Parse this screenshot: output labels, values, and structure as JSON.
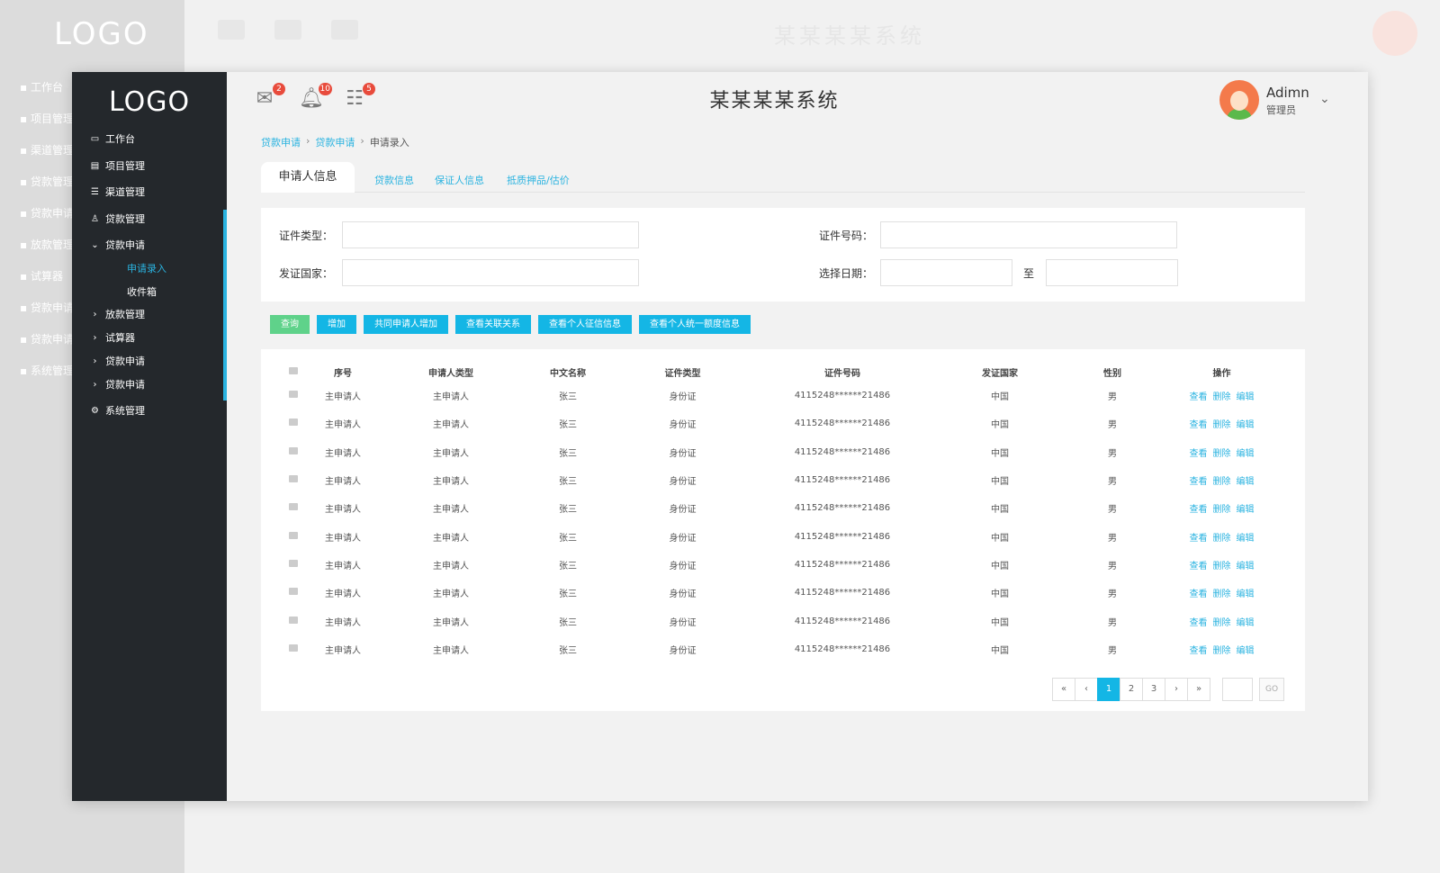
{
  "app": {
    "logo": "LOGO",
    "title": "某某某某系统"
  },
  "topbar": {
    "icons": [
      {
        "name": "mail-icon",
        "badge": "2"
      },
      {
        "name": "bell-icon",
        "badge": "10"
      },
      {
        "name": "list-icon",
        "badge": "5"
      }
    ],
    "user": {
      "name": "Adimn",
      "role": "管理员"
    }
  },
  "sidebar": {
    "items": [
      {
        "label": "工作台",
        "icon": "desktop-icon"
      },
      {
        "label": "项目管理",
        "icon": "project-icon"
      },
      {
        "label": "渠道管理",
        "icon": "channel-icon"
      },
      {
        "label": "贷款管理",
        "icon": "loan-icon"
      },
      {
        "label": "贷款申请",
        "icon": "chevron-down-icon"
      },
      {
        "label": "放款管理",
        "icon": "chevron-right-icon"
      },
      {
        "label": "试算器",
        "icon": "chevron-right-icon"
      },
      {
        "label": "贷款申请",
        "icon": "chevron-right-icon"
      },
      {
        "label": "贷款申请",
        "icon": "chevron-right-icon"
      },
      {
        "label": "系统管理",
        "icon": "gear-icon"
      }
    ],
    "sub_items": [
      {
        "label": "申请录入",
        "active": true
      },
      {
        "label": "收件箱",
        "active": false
      }
    ]
  },
  "breadcrumb": [
    "贷款申请",
    "贷款申请",
    "申请录入"
  ],
  "tabs": [
    "申请人信息",
    "贷款信息",
    "保证人信息",
    "抵质押品/估价"
  ],
  "form": {
    "id_type_label": "证件类型：",
    "id_number_label": "证件号码：",
    "country_label": "发证国家：",
    "date_label": "选择日期：",
    "date_to": "至"
  },
  "buttons": [
    "查询",
    "增加",
    "共同申请人增加",
    "查看关联关系",
    "查看个人征信信息",
    "查看个人统一额度信息"
  ],
  "table": {
    "headers": [
      "序号",
      "申请人类型",
      "中文名称",
      "证件类型",
      "证件号码",
      "发证国家",
      "性别",
      "操作"
    ],
    "rows": [
      [
        "主申请人",
        "主申请人",
        "张三",
        "身份证",
        "4115248******21486",
        "中国",
        "男"
      ],
      [
        "主申请人",
        "主申请人",
        "张三",
        "身份证",
        "4115248******21486",
        "中国",
        "男"
      ],
      [
        "主申请人",
        "主申请人",
        "张三",
        "身份证",
        "4115248******21486",
        "中国",
        "男"
      ],
      [
        "主申请人",
        "主申请人",
        "张三",
        "身份证",
        "4115248******21486",
        "中国",
        "男"
      ],
      [
        "主申请人",
        "主申请人",
        "张三",
        "身份证",
        "4115248******21486",
        "中国",
        "男"
      ],
      [
        "主申请人",
        "主申请人",
        "张三",
        "身份证",
        "4115248******21486",
        "中国",
        "男"
      ],
      [
        "主申请人",
        "主申请人",
        "张三",
        "身份证",
        "4115248******21486",
        "中国",
        "男"
      ],
      [
        "主申请人",
        "主申请人",
        "张三",
        "身份证",
        "4115248******21486",
        "中国",
        "男"
      ],
      [
        "主申请人",
        "主申请人",
        "张三",
        "身份证",
        "4115248******21486",
        "中国",
        "男"
      ],
      [
        "主申请人",
        "主申请人",
        "张三",
        "身份证",
        "4115248******21486",
        "中国",
        "男"
      ]
    ],
    "actions": [
      "查看",
      "删除",
      "编辑"
    ]
  },
  "pagination": {
    "first": "«",
    "prev": "‹",
    "pages": [
      "1",
      "2",
      "3"
    ],
    "current": "1",
    "next": "›",
    "last": "»",
    "go": "GO"
  },
  "background": {
    "nav": [
      "工作台",
      "项目管理",
      "渠道管理",
      "贷款管理",
      "贷款申请",
      "放款管理",
      "试算器",
      "贷款申请",
      "贷款申请",
      "系统管理"
    ]
  },
  "colors": {
    "sidebar_bg": "#24282c",
    "accent": "#14b6e5",
    "query_button": "#5fd28a",
    "badge": "#e84b3c"
  }
}
